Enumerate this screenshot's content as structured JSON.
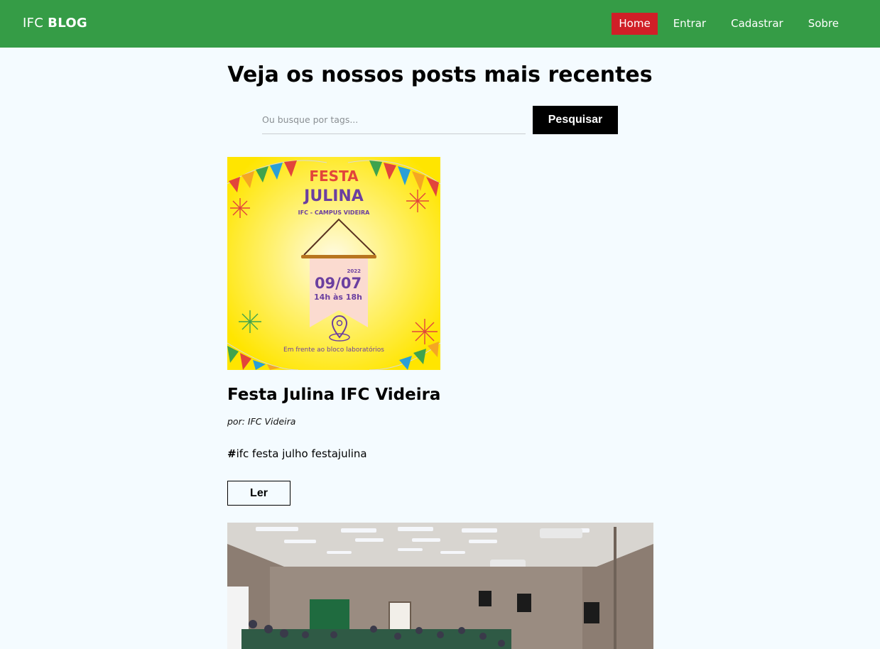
{
  "navbar": {
    "brand_light": "IFC",
    "brand_bold": "BLOG",
    "links": [
      {
        "label": "Home",
        "active": true
      },
      {
        "label": "Entrar",
        "active": false
      },
      {
        "label": "Cadastrar",
        "active": false
      },
      {
        "label": "Sobre",
        "active": false
      }
    ],
    "background_color": "#359c46",
    "active_color": "#d01f27"
  },
  "page": {
    "title": "Veja os nossos posts mais recentes"
  },
  "search": {
    "placeholder": "Ou busque por tags...",
    "value": "",
    "button_label": "Pesquisar"
  },
  "posts": [
    {
      "title": "Festa Julina IFC Videira",
      "author": "por: IFC Videira",
      "tags_hash": "#",
      "tags": "ifc festa julho festajulina",
      "read_label": "Ler",
      "image": {
        "heading_line1": "FESTA",
        "heading_line2": "JULINA",
        "subtitle": "IFC - CAMPUS VIDEIRA",
        "year": "2022",
        "date": "09/07",
        "time": "14h às 18h",
        "location": "Em frente ao bloco laboratórios"
      }
    },
    {
      "image_description_icon": "auditorium-photo"
    }
  ]
}
